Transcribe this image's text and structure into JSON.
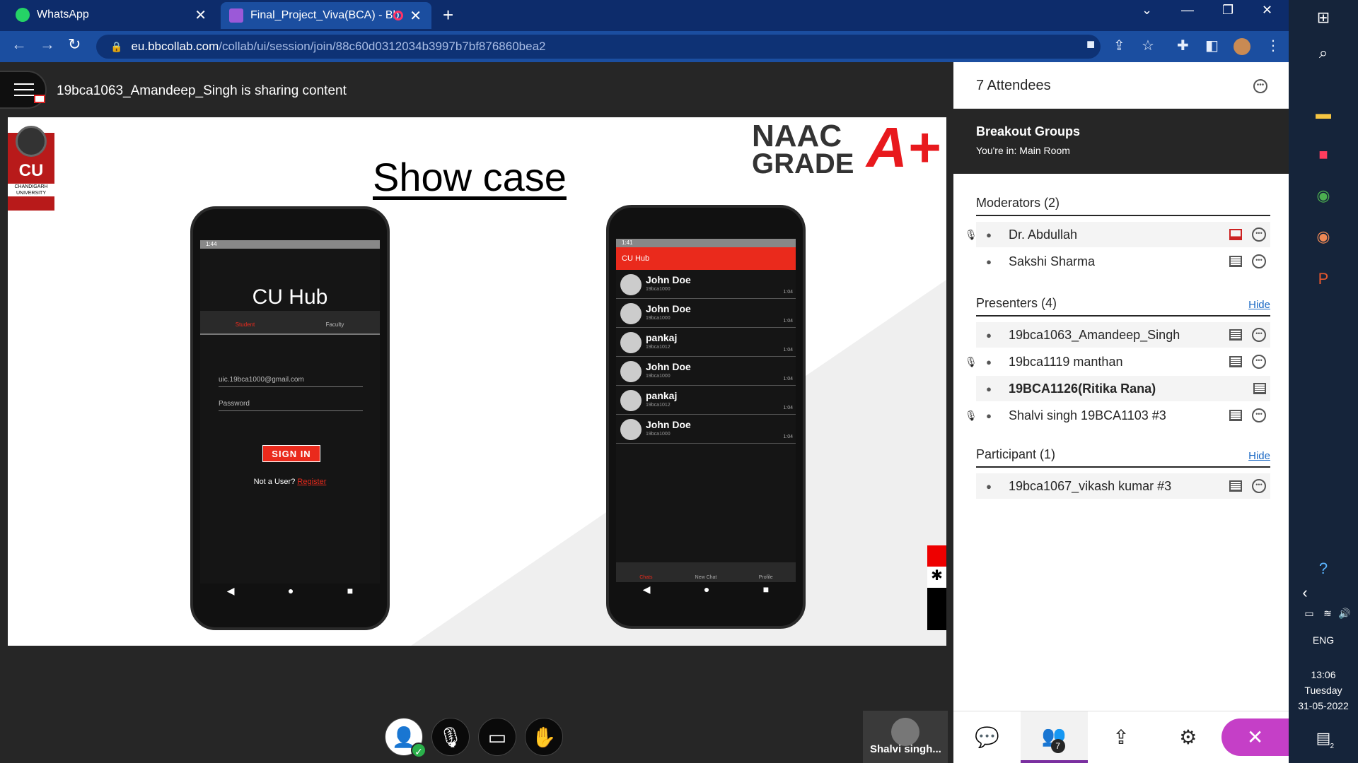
{
  "browser": {
    "tabs": [
      {
        "title": "WhatsApp"
      },
      {
        "title": "Final_Project_Viva(BCA) - Bb"
      }
    ],
    "url_host": "eu.bbcollab.com",
    "url_path": "/collab/ui/session/join/88c60d0312034b3997b7bf876860bea2"
  },
  "session": {
    "sharing_text": "19bca1063_Amandeep_Singh is sharing content"
  },
  "slide": {
    "title": "Show case",
    "cu_logo": "CU",
    "cu_caption": "CHANDIGARH UNIVERSITY",
    "naac_line1": "NAAC",
    "naac_line2": "GRADE",
    "naac_grade": "A+",
    "login_phone": {
      "status": "1:44",
      "app_title": "CU Hub",
      "tab_student": "Student",
      "tab_faculty": "Faculty",
      "email": "uic.19bca1000@gmail.com",
      "password_placeholder": "Password",
      "sign_in": "SIGN IN",
      "not_user": "Not a User?",
      "register": "Register"
    },
    "chat_phone": {
      "status": "1:41",
      "header": "CU Hub",
      "chats": [
        {
          "name": "John Doe",
          "id": "19bca1000",
          "time": "1:04"
        },
        {
          "name": "John Doe",
          "id": "19bca1000",
          "time": "1:04"
        },
        {
          "name": "pankaj",
          "id": "19bca1012",
          "time": "1:04"
        },
        {
          "name": "John Doe",
          "id": "19bca1000",
          "time": "1:04"
        },
        {
          "name": "pankaj",
          "id": "19bca1012",
          "time": "1:04"
        },
        {
          "name": "John Doe",
          "id": "19bca1000",
          "time": "1:04"
        }
      ],
      "nav": [
        "Chats",
        "New Chat",
        "Profile"
      ]
    }
  },
  "panel": {
    "title": "7 Attendees",
    "breakout_title": "Breakout Groups",
    "breakout_sub": "You're in: Main Room",
    "moderators_label": "Moderators (2)",
    "presenters_label": "Presenters (4)",
    "participants_label": "Participant (1)",
    "hide_label": "Hide",
    "moderators": [
      {
        "name": "Dr. Abdullah"
      },
      {
        "name": "Sakshi Sharma"
      }
    ],
    "presenters": [
      {
        "name": "19bca1063_Amandeep_Singh"
      },
      {
        "name": "19bca1119 manthan"
      },
      {
        "name": "19BCA1126(Ritika Rana)"
      },
      {
        "name": "Shalvi singh 19BCA1103 #3"
      }
    ],
    "participants": [
      {
        "name": "19bca1067_vikash kumar #3"
      }
    ],
    "attendee_badge": "7"
  },
  "speaker": {
    "name": "Shalvi singh..."
  },
  "taskbar": {
    "lang": "ENG",
    "time": "13:06",
    "day": "Tuesday",
    "date": "31-05-2022",
    "notif_count": "2"
  },
  "colors": {
    "chrome_bg": "#0d2c6b",
    "accent_purple": "#c53fc7",
    "slide_red": "#ea2a1c"
  }
}
